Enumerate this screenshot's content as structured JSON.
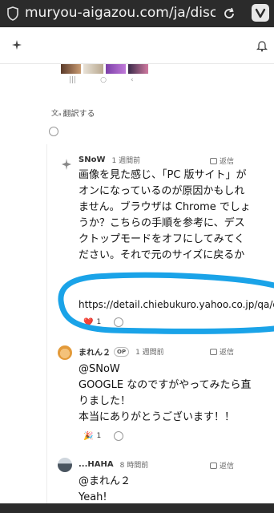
{
  "browser": {
    "url": "muryou-aigazou.com/ja/discussio"
  },
  "translate": {
    "label": "翻訳する"
  },
  "comments": [
    {
      "author": "SNoW",
      "time": "1 週間前",
      "reply_label": "返信",
      "body_lines": [
        "画像を見た感じ、「PC 版サイト」が",
        "オンになっているのが原因かもしれ",
        "ません。ブラウザは Chrome でしょ",
        "うか？こちらの手順を参考に、デス",
        "クトップモードをオフにしてみてく",
        "ださい。それで元のサイズに戻るか"
      ],
      "link": "https://detail.chiebukuro.yahoo.co.jp/qa/qu",
      "reaction_emoji": "❤️",
      "reaction_count": "1"
    },
    {
      "author": "まれん２",
      "op_badge": "OP",
      "time": "1 週間前",
      "reply_label": "返信",
      "body_lines": [
        "@SNoW",
        "GOOGLE なのですがやってみたら直",
        "りました！",
        "本当にありがとうございます！！"
      ],
      "reaction_emoji": "🎉",
      "reaction_count": "1"
    },
    {
      "author": "...HAHA",
      "time": "8 時間前",
      "reply_label": "返信",
      "body_lines": [
        "@まれん２",
        "Yeah!"
      ]
    }
  ],
  "colors": {
    "annotation": "#1aa3e8",
    "browser_bar": "#2b2b2b"
  }
}
